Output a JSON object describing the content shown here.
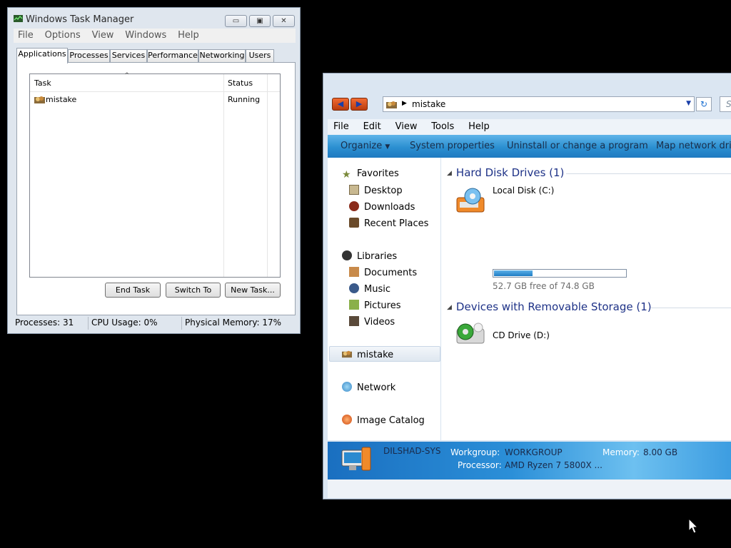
{
  "task_manager": {
    "title": "Windows Task Manager",
    "caption_buttons": {
      "minimize": "▭",
      "maximize": "▣",
      "close": "✕"
    },
    "menu": [
      "File",
      "Options",
      "View",
      "Windows",
      "Help"
    ],
    "tabs": [
      "Applications",
      "Processes",
      "Services",
      "Performance",
      "Networking",
      "Users"
    ],
    "active_tab": "Applications",
    "columns": {
      "task": "Task",
      "status": "Status",
      "sort_indicator": "^"
    },
    "rows": [
      {
        "task": "mistake",
        "status": "Running",
        "icon": "app-icon"
      }
    ],
    "buttons": {
      "end_task": "End Task",
      "switch_to": "Switch To",
      "new_task": "New Task..."
    },
    "status": {
      "processes": "Processes: 31",
      "cpu": "CPU Usage: 0%",
      "memory": "Physical Memory: 17%"
    }
  },
  "explorer": {
    "address": "mistake",
    "search_placeholder": "Se",
    "menu": [
      "File",
      "Edit",
      "View",
      "Tools",
      "Help"
    ],
    "toolbar": {
      "organize": "Organize",
      "system_properties": "System properties",
      "uninstall": "Uninstall or change a program",
      "map_network": "Map network driv"
    },
    "nav": {
      "favorites": "Favorites",
      "desktop": "Desktop",
      "downloads": "Downloads",
      "recent": "Recent Places",
      "libraries": "Libraries",
      "documents": "Documents",
      "music": "Music",
      "pictures": "Pictures",
      "videos": "Videos",
      "computer": "mistake",
      "network": "Network",
      "image_catalog": "Image Catalog"
    },
    "groups": {
      "hdd": "Hard Disk Drives (1)",
      "removable": "Devices with Removable Storage (1)"
    },
    "local_disk": {
      "name": "Local Disk (C:)",
      "free_text": "52.7 GB free of 74.8 GB",
      "used_fraction": 0.295
    },
    "cd_drive": {
      "name": "CD Drive (D:)"
    },
    "details": {
      "computer_name": "DILSHAD-SYS",
      "workgroup_label": "Workgroup:",
      "workgroup": "WORKGROUP",
      "memory_label": "Memory:",
      "memory": "8.00 GB",
      "processor_label": "Processor:",
      "processor": "AMD Ryzen 7 5800X ..."
    }
  },
  "colors": {
    "toolbar_blue": "#2b8fd1",
    "group_heading": "#1e3287",
    "nav_arrow_orange": "#e8541e"
  }
}
